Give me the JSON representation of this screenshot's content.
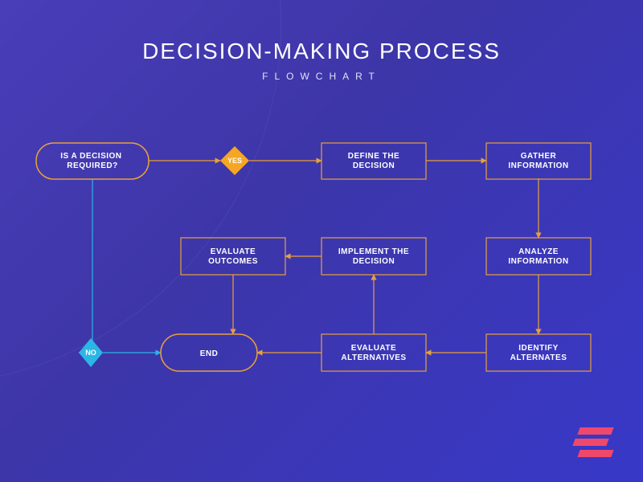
{
  "title": "DECISION-MAKING PROCESS",
  "subtitle": "FLOWCHART",
  "nodes": {
    "start": "IS A DECISION REQUIRED?",
    "yes": "YES",
    "no": "NO",
    "define": "DEFINE THE DECISION",
    "gather": "GATHER INFORMATION",
    "analyze": "ANALYZE INFORMATION",
    "identify": "IDENTIFY ALTERNATES",
    "eval_alt": "EVALUATE ALTERNATIVES",
    "implement": "IMPLEMENT THE DECISION",
    "eval_out": "EVALUATE OUTCOMES",
    "end": "END"
  },
  "colors": {
    "accent": "#e8a03a",
    "yes_diamond": "#f5a623",
    "no_diamond": "#2bb6e6",
    "logo": "#f0486a"
  },
  "flow": [
    [
      "start",
      "yes"
    ],
    [
      "yes",
      "define"
    ],
    [
      "define",
      "gather"
    ],
    [
      "gather",
      "analyze"
    ],
    [
      "analyze",
      "identify"
    ],
    [
      "identify",
      "eval_alt"
    ],
    [
      "eval_alt",
      "implement"
    ],
    [
      "implement",
      "eval_out"
    ],
    [
      "eval_out",
      "end"
    ],
    [
      "eval_alt",
      "end"
    ],
    [
      "start",
      "no"
    ],
    [
      "no",
      "end"
    ]
  ]
}
